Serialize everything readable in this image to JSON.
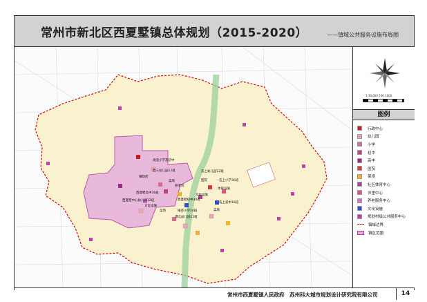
{
  "header": {
    "title": "常州市新北区西夏墅镇总体规划（2015-2020）",
    "subtitle": "——镇域公共服务设施布局图"
  },
  "scale": {
    "text": "1:30,000 500 1000"
  },
  "legend": {
    "title": "图例",
    "items": [
      {
        "label": "行政中心",
        "icon": "admin-center-icon",
        "color": "#c81e1e"
      },
      {
        "label": "幼儿园",
        "icon": "kindergarten-icon",
        "color": "#f2a3b2"
      },
      {
        "label": "小学",
        "icon": "primary-school-icon",
        "color": "#d96b8f"
      },
      {
        "label": "初中",
        "icon": "middle-school-icon",
        "color": "#c04080"
      },
      {
        "label": "高中",
        "icon": "high-school-icon",
        "color": "#9b2f7a"
      },
      {
        "label": "医院",
        "icon": "hospital-icon",
        "color": "#e03a3a"
      },
      {
        "label": "菜场",
        "icon": "market-icon",
        "color": "#f0b030"
      },
      {
        "label": "社区体育中心",
        "icon": "sports-center-icon",
        "color": "#b04090"
      },
      {
        "label": "邻里中心",
        "icon": "neighborhood-center-icon",
        "color": "#e0508a"
      },
      {
        "label": "养老服务中心",
        "icon": "elderly-care-icon",
        "color": "#d070c0"
      },
      {
        "label": "文化设施",
        "icon": "culture-facility-icon",
        "color": "#3050c0"
      },
      {
        "label": "规划村级公共服务中心",
        "icon": "village-service-icon",
        "color": "#c040b0"
      },
      {
        "label": "镇域边界",
        "icon": "town-boundary-icon",
        "color": "#d01818"
      },
      {
        "label": "镇区范围",
        "icon": "town-area-icon",
        "color": "#e5b0dc"
      }
    ]
  },
  "map_labels": [
    "街道小学及初中",
    "西三幼儿园12班",
    "镇政府",
    "菜场",
    "养老院",
    "西夏墅高中36班",
    "西夏墅中心幼儿园12班",
    "文化设施",
    "西夏墅初中30班",
    "菜场",
    "银杏小学24班",
    "港北幼儿园15班",
    "浩上幼儿园12班",
    "医院",
    "浩上小学36班",
    "文化设施",
    "体育设施",
    "浩上初中18班",
    "菜场"
  ],
  "footer": {
    "org": "常州市西夏墅镇人民政府　苏州科大城市规划设计研究院有限公司",
    "page": "14"
  }
}
